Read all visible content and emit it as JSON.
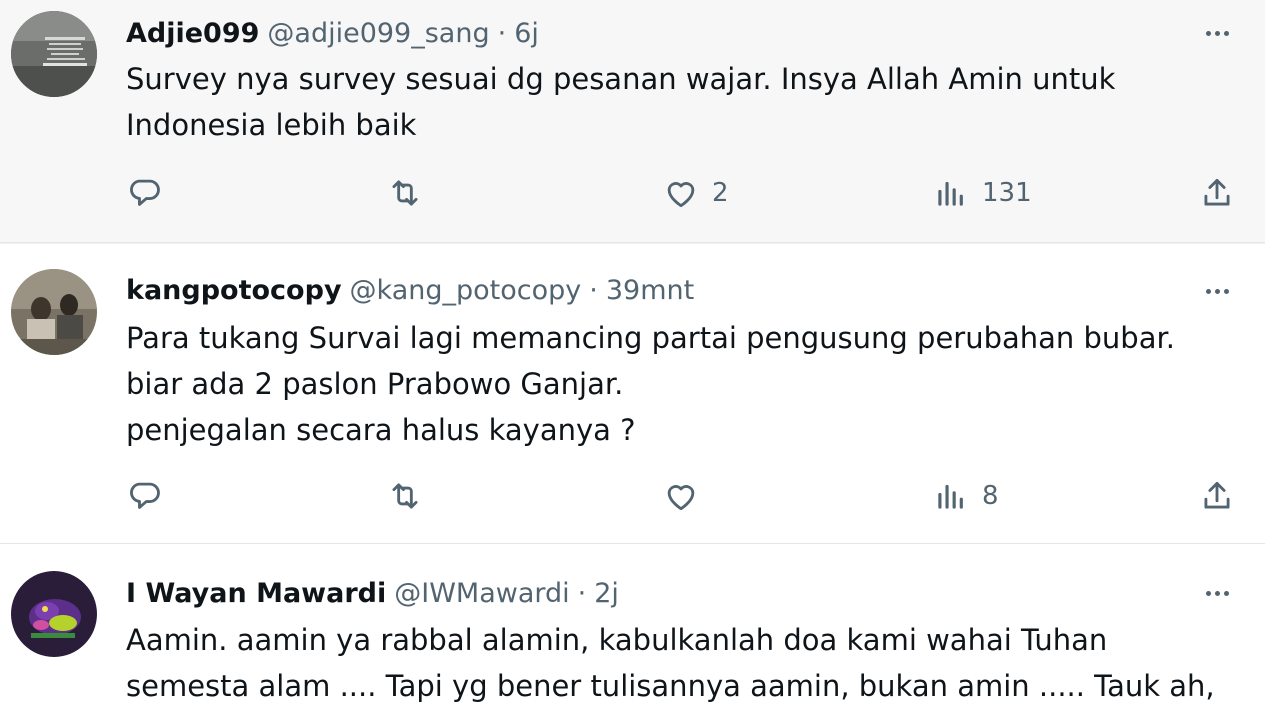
{
  "tweets": [
    {
      "name": "Adjie099",
      "handle": "@adjie099_sang",
      "separator": "·",
      "time": "6j",
      "lines": [
        "Survey nya survey sesuai dg pesanan wajar. Insya Allah Amin untuk",
        "Indonesia lebih baik"
      ],
      "likes": "2",
      "views": "131"
    },
    {
      "name": "kangpotocopy",
      "handle": "@kang_potocopy",
      "separator": "·",
      "time": "39mnt",
      "lines": [
        "Para tukang Survai lagi memancing partai pengusung perubahan bubar.",
        "biar ada 2 paslon Prabowo Ganjar.",
        "penjegalan secara halus kayanya ?"
      ],
      "likes": "",
      "views": "8"
    },
    {
      "name": "I Wayan Mawardi",
      "handle": "@IWMawardi",
      "separator": "·",
      "time": "2j",
      "lines": [
        "Aamin. aamin ya rabbal alamin, kabulkanlah doa kami wahai Tuhan",
        "semesta alam .... Tapi yg bener tulisannya aamin, bukan amin ..... Tauk ah,"
      ]
    }
  ],
  "icons": {
    "reply": "reply-icon",
    "retweet": "retweet-icon",
    "like": "heart-icon",
    "views": "views-icon",
    "share": "share-icon",
    "more": "more-icon"
  },
  "colors": {
    "text": "#0f1419",
    "secondary": "#536471",
    "highlight_bg": "#f7f7f7"
  }
}
